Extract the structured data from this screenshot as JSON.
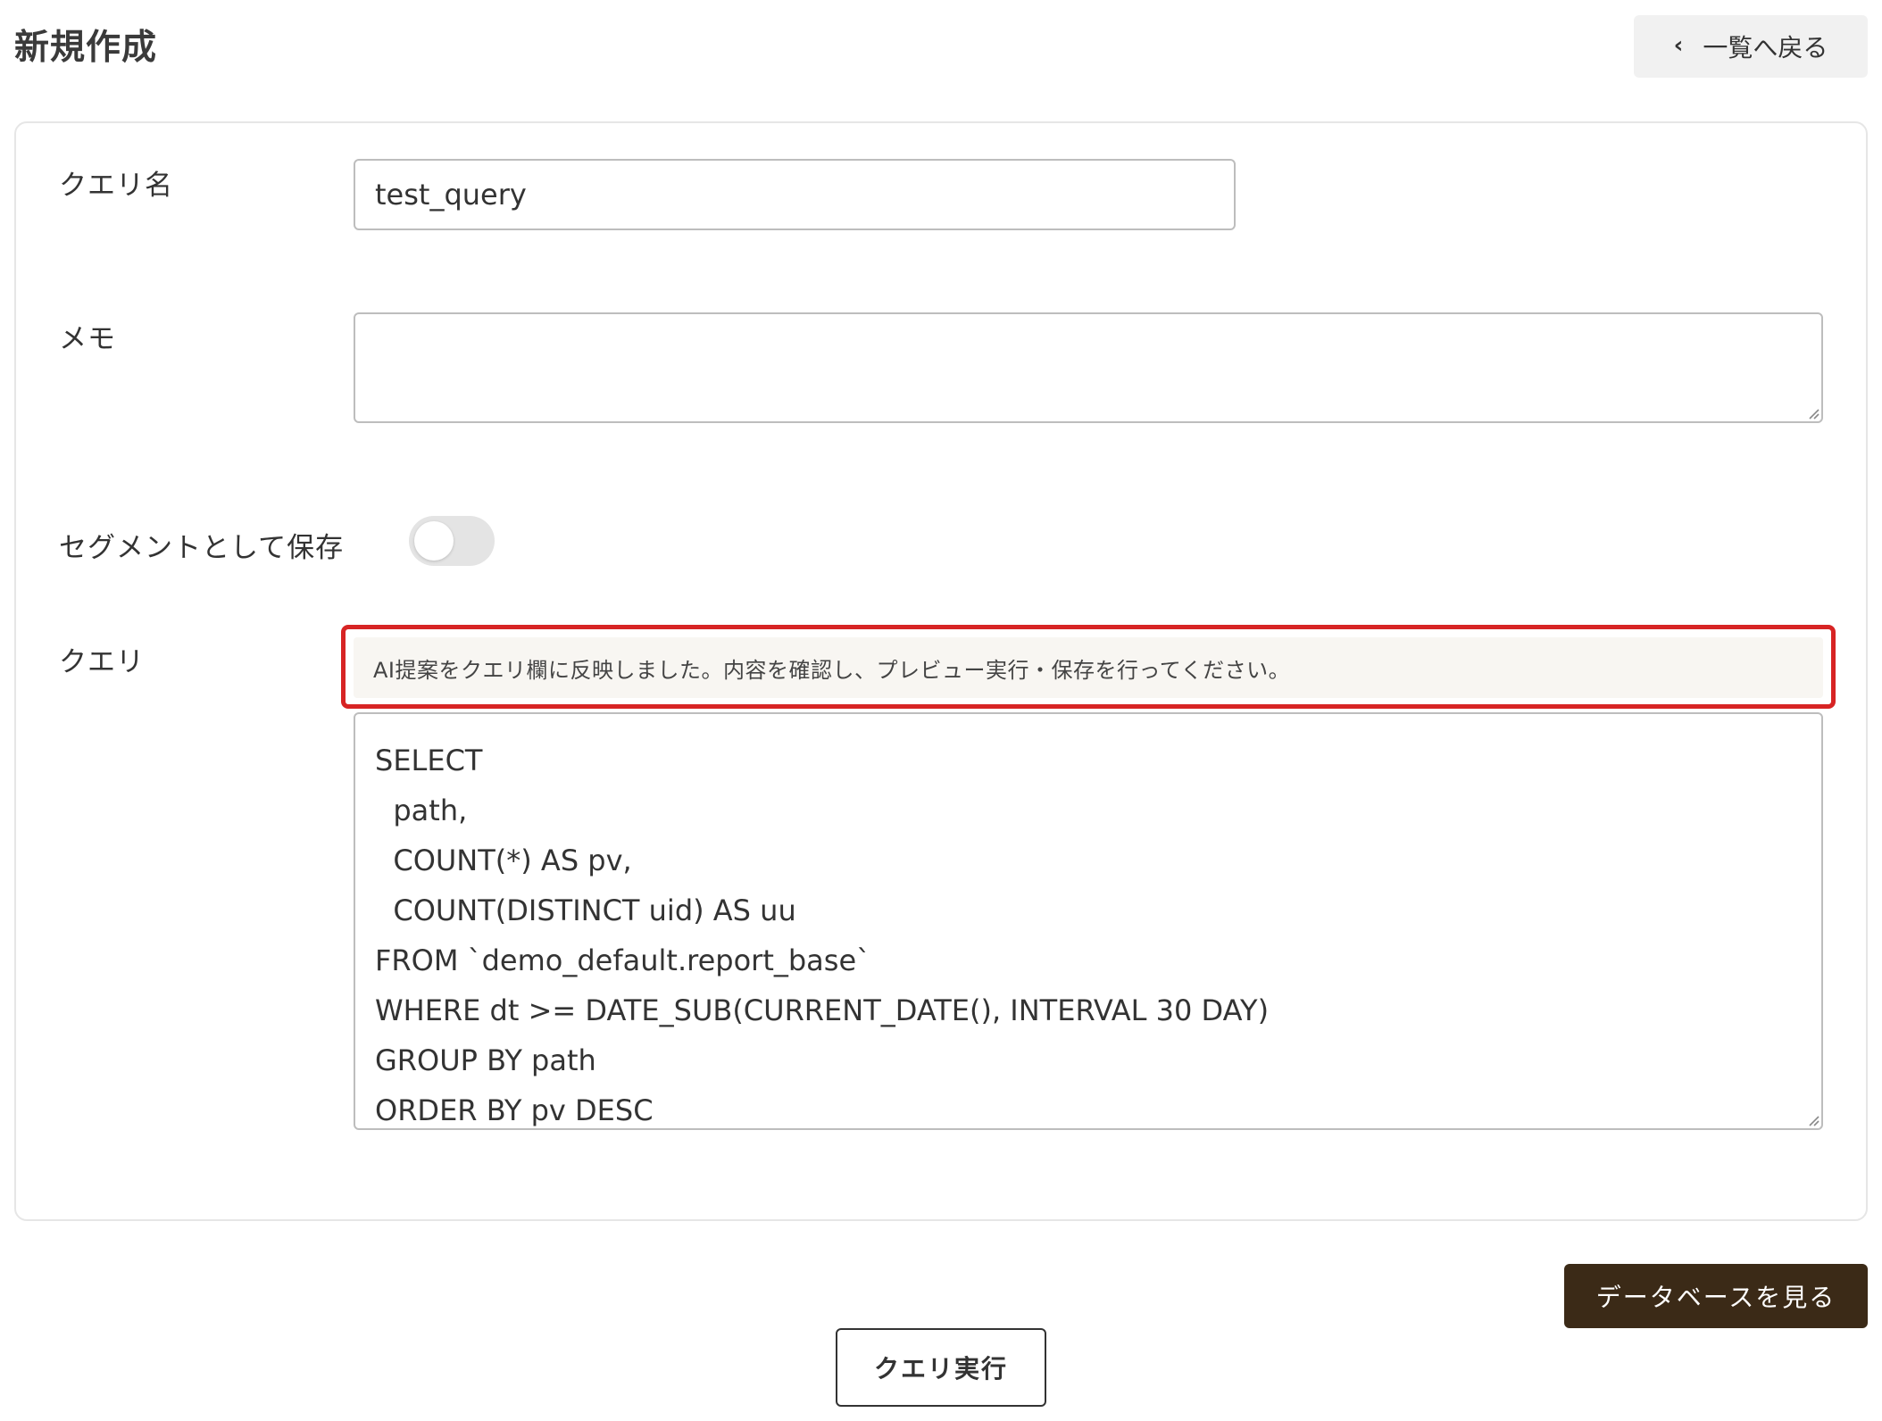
{
  "header": {
    "title": "新規作成",
    "back_label": "一覧へ戻る"
  },
  "form": {
    "name": {
      "label": "クエリ名",
      "value": "test_query"
    },
    "memo": {
      "label": "メモ",
      "value": ""
    },
    "segment": {
      "label": "セグメントとして保存",
      "enabled": false
    },
    "query": {
      "label": "クエリ",
      "notice": "AI提案をクエリ欄に反映しました。内容を確認し、プレビュー実行・保存を行ってください。",
      "lines": [
        "SELECT",
        "  path,",
        "  COUNT(*) AS pv,",
        "  COUNT(DISTINCT uid) AS uu",
        "FROM `demo_default.report_base`",
        "WHERE dt >= DATE_SUB(CURRENT_DATE(), INTERVAL 30 DAY)",
        "GROUP BY path",
        "ORDER BY pv DESC"
      ]
    }
  },
  "actions": {
    "view_database_label": "データベースを見る",
    "run_query_label": "クエリ実行"
  },
  "colors": {
    "highlight_border": "#d72424",
    "primary_button": "#3b2a17",
    "notice_background": "#f8f6f2"
  }
}
